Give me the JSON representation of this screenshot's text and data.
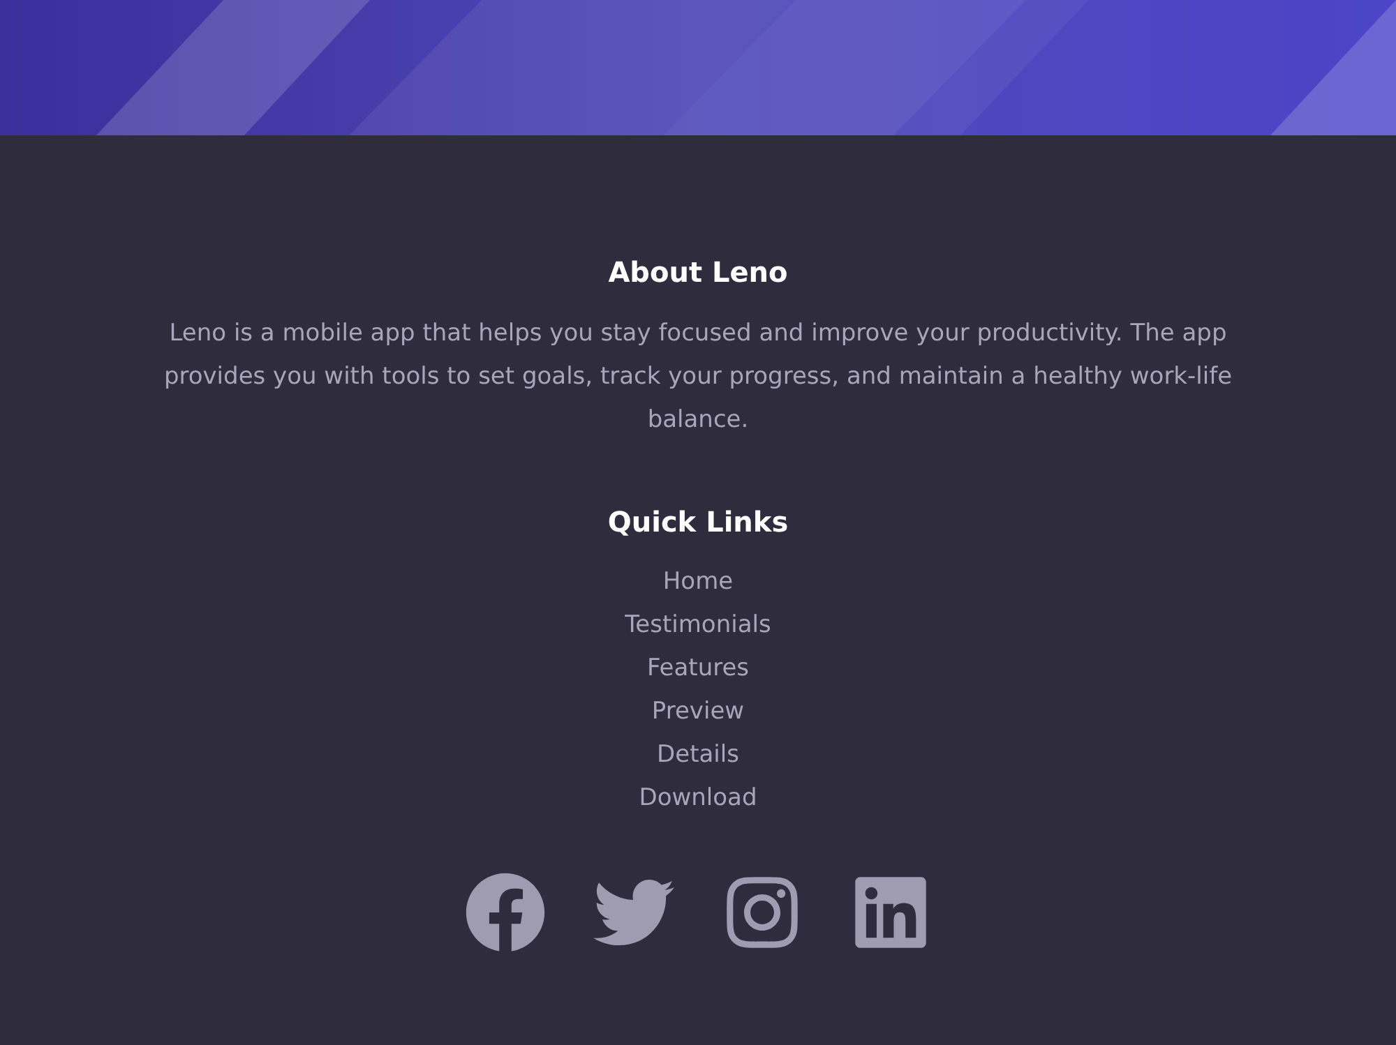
{
  "about": {
    "title": "About Leno",
    "text": "Leno is a mobile app that helps you stay focused and improve your productivity. The app provides you with tools to set goals, track your progress, and maintain a healthy work-life balance."
  },
  "quick_links": {
    "title": "Quick Links",
    "links": [
      "Home",
      "Testimonials",
      "Features",
      "Preview",
      "Details",
      "Download"
    ]
  }
}
